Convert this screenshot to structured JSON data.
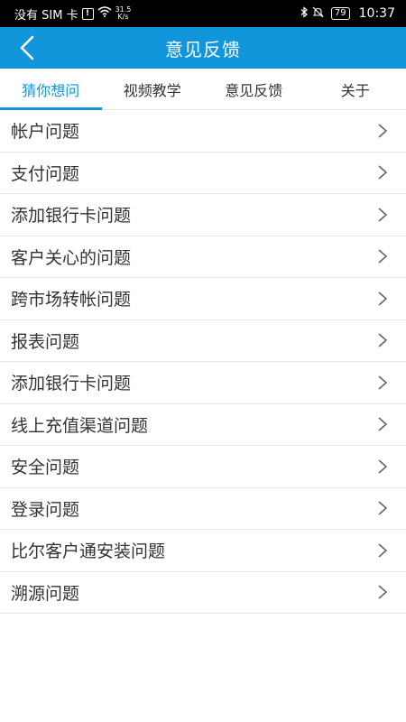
{
  "status_bar": {
    "carrier": "没有 SIM 卡",
    "alert_glyph": "!",
    "net_speed_value": "31.5",
    "net_speed_unit": "K/s",
    "battery": "79",
    "time": "10:37"
  },
  "app_bar": {
    "title": "意见反馈"
  },
  "tabs": [
    {
      "label": "猜你想问"
    },
    {
      "label": "视频教学"
    },
    {
      "label": "意见反馈"
    },
    {
      "label": "关于"
    }
  ],
  "active_tab_index": 0,
  "faq_items": [
    {
      "label": "帐户问题"
    },
    {
      "label": "支付问题"
    },
    {
      "label": "添加银行卡问题"
    },
    {
      "label": "客户关心的问题"
    },
    {
      "label": "跨市场转帐问题"
    },
    {
      "label": "报表问题"
    },
    {
      "label": "添加银行卡问题"
    },
    {
      "label": "线上充值渠道问题"
    },
    {
      "label": "安全问题"
    },
    {
      "label": "登录问题"
    },
    {
      "label": "比尔客户通安装问题"
    },
    {
      "label": "溯源问题"
    }
  ],
  "colors": {
    "accent": "#1296db",
    "status_bar_bg": "#000000",
    "text": "#333333",
    "divider": "#e8e8e8"
  },
  "icons": {
    "back": "back-arrow-icon",
    "row": "chevron-right-icon",
    "wifi": "wifi-icon",
    "bluetooth": "bluetooth-icon",
    "mute": "bell-off-icon",
    "battery": "battery-icon"
  }
}
